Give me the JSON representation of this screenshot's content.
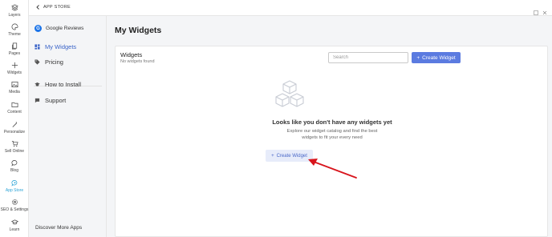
{
  "rail": {
    "items": [
      {
        "label": "Layers",
        "icon": "layers-icon"
      },
      {
        "label": "Theme",
        "icon": "palette-icon"
      },
      {
        "label": "Pages",
        "icon": "pages-icon"
      },
      {
        "label": "Widgets",
        "icon": "plus-icon"
      },
      {
        "label": "Media",
        "icon": "image-icon"
      },
      {
        "label": "Content",
        "icon": "folder-icon"
      },
      {
        "label": "Personalize",
        "icon": "wand-icon"
      },
      {
        "label": "Sell Online",
        "icon": "cart-icon"
      },
      {
        "label": "Blog",
        "icon": "chat-icon"
      },
      {
        "label": "App Store",
        "icon": "app-store-icon",
        "active": true
      },
      {
        "label": "SEO & Settings",
        "icon": "gear-icon"
      },
      {
        "label": "Learn",
        "icon": "graduation-cap-icon"
      }
    ],
    "active_color": "#2aa3d6"
  },
  "topbar": {
    "back_label": "APP STORE"
  },
  "sidebar": {
    "app_name": "Google Reviews",
    "items": [
      {
        "label": "My Widgets",
        "icon": "widgets-grid-icon",
        "active": true
      },
      {
        "label": "Pricing",
        "icon": "tag-icon"
      },
      {
        "label": "How to Install",
        "icon": "graduation-cap-icon"
      },
      {
        "label": "Support",
        "icon": "support-icon"
      }
    ],
    "discover": "Discover More Apps"
  },
  "main": {
    "title": "My Widgets",
    "card_title": "Widgets",
    "card_sub": "No widgets found",
    "search_placeholder": "Search",
    "create_top": "Create Widget",
    "empty_title": "Looks like you don't have any widgets yet",
    "empty_desc_1": "Explore our widget catalog and find the best",
    "empty_desc_2": "widgets to fit your every need",
    "create_center": "Create Widget",
    "accent": "#5b7be0",
    "annotation_arrow_color": "#d8141c"
  }
}
